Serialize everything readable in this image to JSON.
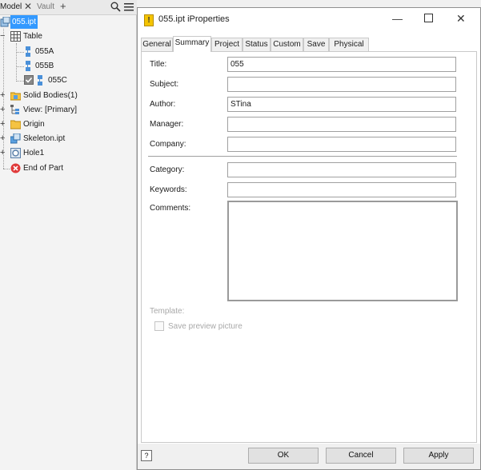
{
  "browser": {
    "tabs": {
      "model": "Model",
      "vault": "Vault"
    },
    "tree": {
      "root": "055.ipt",
      "table": "Table",
      "rows": [
        "055A",
        "055B",
        "055C"
      ],
      "solid_bodies": "Solid Bodies(1)",
      "view": "View: [Primary]",
      "origin": "Origin",
      "skeleton": "Skeleton.ipt",
      "hole": "Hole1",
      "end": "End of Part"
    }
  },
  "dialog": {
    "title": "055.ipt iProperties",
    "tabs": [
      "General",
      "Summary",
      "Project",
      "Status",
      "Custom",
      "Save",
      "Physical"
    ],
    "active_tab": "Summary",
    "labels": {
      "title": "Title:",
      "subject": "Subject:",
      "author": "Author:",
      "manager": "Manager:",
      "company": "Company:",
      "category": "Category:",
      "keywords": "Keywords:",
      "comments": "Comments:",
      "template": "Template:",
      "save_preview": "Save preview picture"
    },
    "values": {
      "title": "055",
      "subject": "",
      "author": "STina",
      "manager": "",
      "company": "",
      "category": "",
      "keywords": "",
      "comments": ""
    },
    "buttons": {
      "ok": "OK",
      "cancel": "Cancel",
      "apply": "Apply"
    },
    "help": "?"
  }
}
